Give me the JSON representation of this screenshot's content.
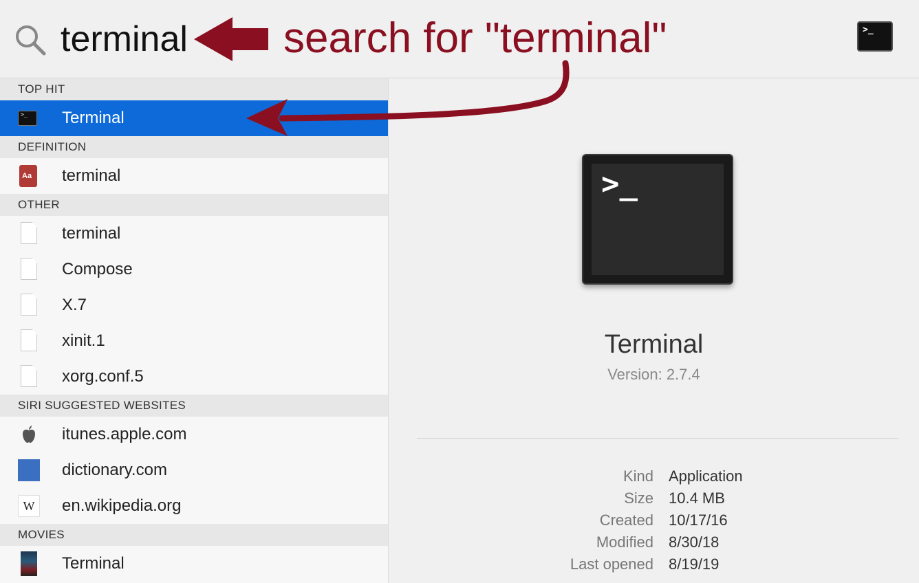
{
  "search": {
    "value": "terminal"
  },
  "annotation": {
    "text": "search for \"terminal\"",
    "color": "#8a0f20"
  },
  "top_app_icon": {
    "glyph": ">_"
  },
  "results": {
    "sections": [
      {
        "header": "TOP HIT",
        "items": [
          {
            "label": "Terminal",
            "icon": "terminal-icon",
            "selected": true
          }
        ]
      },
      {
        "header": "DEFINITION",
        "items": [
          {
            "label": "terminal",
            "icon": "dictionary-icon"
          }
        ]
      },
      {
        "header": "OTHER",
        "items": [
          {
            "label": "terminal",
            "icon": "document-icon"
          },
          {
            "label": "Compose",
            "icon": "document-icon"
          },
          {
            "label": "X.7",
            "icon": "document-icon"
          },
          {
            "label": "xinit.1",
            "icon": "document-icon"
          },
          {
            "label": "xorg.conf.5",
            "icon": "document-icon"
          }
        ]
      },
      {
        "header": "SIRI SUGGESTED WEBSITES",
        "items": [
          {
            "label": "itunes.apple.com",
            "icon": "apple-icon"
          },
          {
            "label": "dictionary.com",
            "icon": "dictionary-com-icon"
          },
          {
            "label": "en.wikipedia.org",
            "icon": "wikipedia-icon"
          }
        ]
      },
      {
        "header": "MOVIES",
        "items": [
          {
            "label": "Terminal",
            "icon": "movie-poster-icon"
          }
        ]
      }
    ],
    "dictionary_icon_text": "Aa",
    "wikipedia_icon_text": "W",
    "terminal_icon_glyph": ">_"
  },
  "preview": {
    "icon_glyph": ">_",
    "app_name": "Terminal",
    "version": "Version: 2.7.4",
    "meta": [
      {
        "key": "Kind",
        "value": "Application"
      },
      {
        "key": "Size",
        "value": "10.4 MB"
      },
      {
        "key": "Created",
        "value": "10/17/16"
      },
      {
        "key": "Modified",
        "value": "8/30/18"
      },
      {
        "key": "Last opened",
        "value": "8/19/19"
      }
    ]
  },
  "colors": {
    "selection": "#0d6ad8",
    "annotation": "#8a0f20",
    "section_header_bg": "#e7e7e7"
  }
}
